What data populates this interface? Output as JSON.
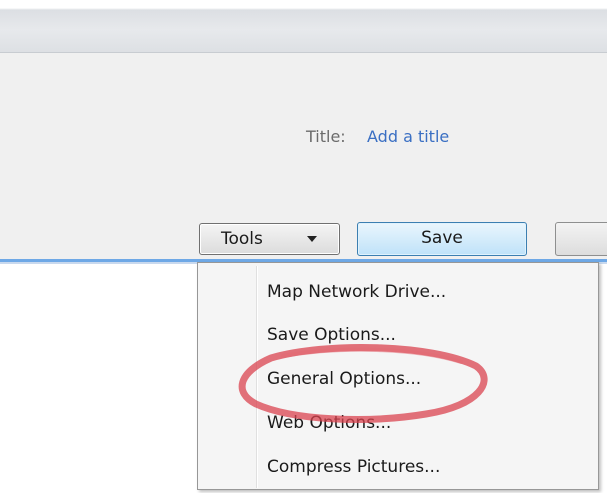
{
  "dialog": {
    "title_label": "Title:",
    "title_link": "Add a title"
  },
  "buttons": {
    "tools_label": "Tools",
    "save_label": "Save"
  },
  "tools_menu": {
    "items": [
      "Map Network Drive...",
      "Save Options...",
      "General Options...",
      "Web Options...",
      "Compress Pictures..."
    ],
    "highlighted_item": "General Options..."
  },
  "colors": {
    "link": "#3a6fc3",
    "annotation": "#d9434f",
    "separator": "#6ea8e6"
  }
}
